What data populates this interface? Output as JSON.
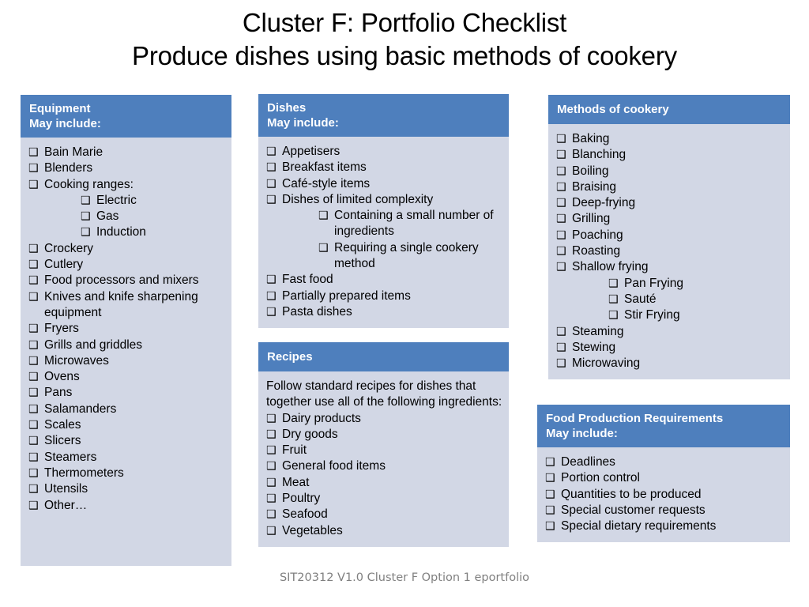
{
  "title": {
    "line1": "Cluster F: Portfolio Checklist",
    "line2": "Produce dishes using basic methods of cookery"
  },
  "colors": {
    "header_blue": "#4E7FBD",
    "body_fill": "#D2D7E5",
    "title_text": "#000000",
    "footer_text": "#808080"
  },
  "checkbox_glyph": "❑",
  "panels": {
    "equipment": {
      "header_line1": "Equipment",
      "header_line2": "May include:",
      "items": [
        {
          "text": "Bain Marie",
          "indent": 0
        },
        {
          "text": "Blenders",
          "indent": 0
        },
        {
          "text": "Cooking ranges:",
          "indent": 0
        },
        {
          "text": "Electric",
          "indent": 1
        },
        {
          "text": "Gas",
          "indent": 1
        },
        {
          "text": "Induction",
          "indent": 1
        },
        {
          "text": "Crockery",
          "indent": 0
        },
        {
          "text": "Cutlery",
          "indent": 0
        },
        {
          "text": "Food processors and mixers",
          "indent": 0
        },
        {
          "text": "Knives and knife sharpening equipment",
          "indent": 0
        },
        {
          "text": "Fryers",
          "indent": 0
        },
        {
          "text": "Grills and griddles",
          "indent": 0
        },
        {
          "text": "Microwaves",
          "indent": 0
        },
        {
          "text": "Ovens",
          "indent": 0
        },
        {
          "text": "Pans",
          "indent": 0
        },
        {
          "text": "Salamanders",
          "indent": 0
        },
        {
          "text": "Scales",
          "indent": 0
        },
        {
          "text": "Slicers",
          "indent": 0
        },
        {
          "text": "Steamers",
          "indent": 0
        },
        {
          "text": "Thermometers",
          "indent": 0
        },
        {
          "text": "Utensils",
          "indent": 0
        },
        {
          "text": "Other…",
          "indent": 0
        }
      ]
    },
    "dishes": {
      "header_line1": "Dishes",
      "header_line2": "May include:",
      "items": [
        {
          "text": "Appetisers",
          "indent": 0
        },
        {
          "text": "Breakfast items",
          "indent": 0
        },
        {
          "text": "Café-style items",
          "indent": 0
        },
        {
          "text": "Dishes of limited complexity",
          "indent": 0
        },
        {
          "text": "Containing a small number of ingredients",
          "indent": 1
        },
        {
          "text": "Requiring a single cookery method",
          "indent": 1
        },
        {
          "text": "Fast food",
          "indent": 0
        },
        {
          "text": "Partially prepared items",
          "indent": 0
        },
        {
          "text": "Pasta dishes",
          "indent": 0
        }
      ]
    },
    "recipes": {
      "header_line1": "Recipes",
      "header_line2": "",
      "lead": "Follow standard recipes for dishes that together use all of the following ingredients:",
      "items": [
        {
          "text": "Dairy products",
          "indent": 0
        },
        {
          "text": "Dry goods",
          "indent": 0
        },
        {
          "text": "Fruit",
          "indent": 0
        },
        {
          "text": "General food items",
          "indent": 0
        },
        {
          "text": "Meat",
          "indent": 0
        },
        {
          "text": "Poultry",
          "indent": 0
        },
        {
          "text": "Seafood",
          "indent": 0
        },
        {
          "text": "Vegetables",
          "indent": 0
        }
      ]
    },
    "methods": {
      "header_line1": "Methods of cookery",
      "header_line2": "",
      "items": [
        {
          "text": "Baking",
          "indent": 0
        },
        {
          "text": "Blanching",
          "indent": 0
        },
        {
          "text": "Boiling",
          "indent": 0
        },
        {
          "text": "Braising",
          "indent": 0
        },
        {
          "text": "Deep-frying",
          "indent": 0
        },
        {
          "text": "Grilling",
          "indent": 0
        },
        {
          "text": "Poaching",
          "indent": 0
        },
        {
          "text": "Roasting",
          "indent": 0
        },
        {
          "text": "Shallow frying",
          "indent": 0
        },
        {
          "text": "Pan Frying",
          "indent": 1
        },
        {
          "text": "Sauté",
          "indent": 1
        },
        {
          "text": "Stir Frying",
          "indent": 1
        },
        {
          "text": "Steaming",
          "indent": 0
        },
        {
          "text": "Stewing",
          "indent": 0
        },
        {
          "text": "Microwaving",
          "indent": 0
        }
      ]
    },
    "food_production_requirements": {
      "header_line1": "Food Production Requirements",
      "header_line2": "May include:",
      "items": [
        {
          "text": "Deadlines",
          "indent": 0
        },
        {
          "text": "Portion control",
          "indent": 0
        },
        {
          "text": "Quantities to be produced",
          "indent": 0
        },
        {
          "text": "Special customer requests",
          "indent": 0
        },
        {
          "text": "Special dietary requirements",
          "indent": 0
        }
      ]
    }
  },
  "footer": "SIT20312 V1.0 Cluster F Option 1 eportfolio"
}
